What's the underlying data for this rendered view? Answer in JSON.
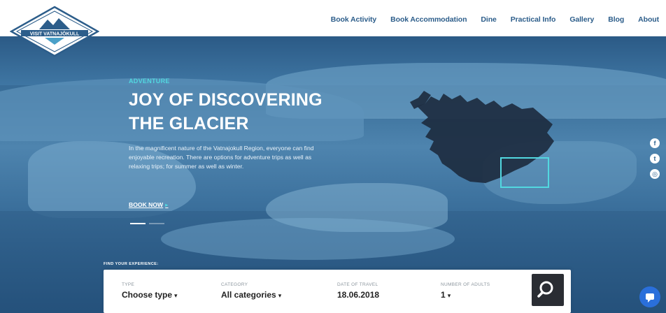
{
  "nav": {
    "items": [
      {
        "label": "Book Activity",
        "name": "nav-book-activity"
      },
      {
        "label": "Book Accommodation",
        "name": "nav-book-accommodation"
      },
      {
        "label": "Dine",
        "name": "nav-dine"
      },
      {
        "label": "Practical Info",
        "name": "nav-practical-info"
      },
      {
        "label": "Gallery",
        "name": "nav-gallery"
      },
      {
        "label": "Blog",
        "name": "nav-blog"
      },
      {
        "label": "About",
        "name": "nav-about"
      }
    ]
  },
  "logo": {
    "text": "VISIT VATNAJÖKULL"
  },
  "hero": {
    "kicker": "ADVENTURE",
    "headline_line1": "JOY OF DISCOVERING",
    "headline_line2": "THE GLACIER",
    "intro": "In the magnificent nature of the Vatnajokull Region, everyone can find enjoyable recreation. There are options for adventure trips as well as relaxing trips; for summer as well as winter.",
    "cta": "BOOK NOW",
    "cta_arrow": "▸",
    "slides_total": 2,
    "slide_active": 1
  },
  "social": [
    {
      "name": "facebook-icon",
      "glyph": "f"
    },
    {
      "name": "twitter-icon",
      "glyph": "t"
    },
    {
      "name": "instagram-icon",
      "glyph": "◎"
    }
  ],
  "finder": {
    "label": "FIND YOUR EXPERIENCE:",
    "fields": [
      {
        "label": "TYPE",
        "value": "Choose type",
        "caret": "▾"
      },
      {
        "label": "CATEGORY",
        "value": "All categories",
        "caret": "▾"
      },
      {
        "label": "DATE OF TRAVEL",
        "value": "18.06.2018",
        "caret": ""
      },
      {
        "label": "NUMBER OF ADULTS",
        "value": "1",
        "caret": "▾"
      }
    ]
  },
  "colors": {
    "accent": "#52d8e0",
    "nav": "#2c5d8a",
    "search_button": "#2a2d33",
    "chat": "#2a6fdb"
  }
}
